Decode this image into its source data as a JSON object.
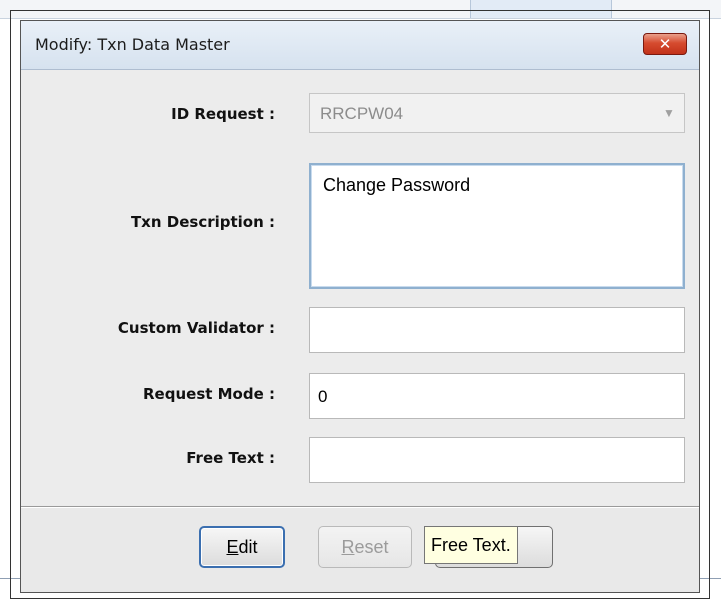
{
  "window": {
    "title": "Modify: Txn Data Master",
    "close_glyph": "✕",
    "close_icon": "close-icon"
  },
  "form": {
    "id_request": {
      "label": "ID Request :",
      "value": "RRCPW04",
      "arrow": "▼"
    },
    "txn_description": {
      "label": "Txn Description :",
      "value": "Change Password"
    },
    "custom_validator": {
      "label": "Custom Validator :",
      "value": ""
    },
    "request_mode": {
      "label": "Request Mode :",
      "value": "0"
    },
    "free_text": {
      "label": "Free Text :",
      "value": ""
    }
  },
  "buttons": {
    "edit": {
      "mnemonic": "E",
      "rest": "dit"
    },
    "reset": {
      "mnemonic": "R",
      "rest": "eset"
    }
  },
  "tooltip": {
    "text": "Free Text."
  },
  "colors": {
    "close_button": "#c2321a",
    "focus_border": "#3b6fb0",
    "tooltip_bg": "#ffffe1"
  }
}
